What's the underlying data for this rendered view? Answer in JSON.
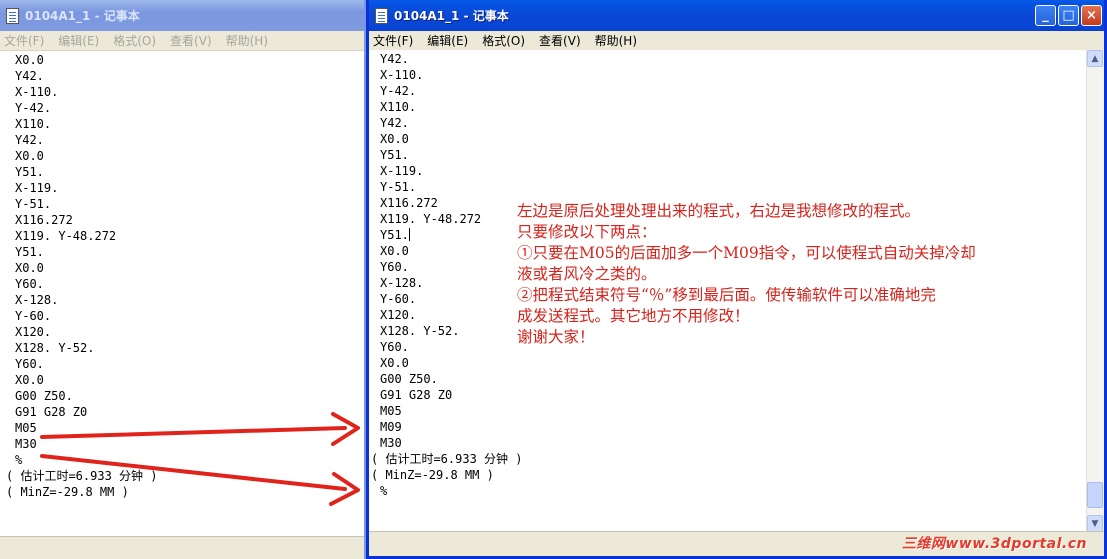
{
  "left_window": {
    "title": "0104A1_1 - 记事本",
    "menu": [
      "文件(F)",
      "编辑(E)",
      "格式(O)",
      "查看(V)",
      "帮助(H)"
    ],
    "lines": [
      "X0.0",
      "Y42.",
      "X-110.",
      "Y-42.",
      "X110.",
      "Y42.",
      "X0.0",
      "Y51.",
      "X-119.",
      "Y-51.",
      "X116.272",
      "X119. Y-48.272",
      "Y51.",
      "X0.0",
      "Y60.",
      "X-128.",
      "Y-60.",
      "X120.",
      "X128. Y-52.",
      "Y60.",
      "X0.0",
      "G00 Z50.",
      "G91 G28 Z0",
      "M05",
      "M30",
      "%",
      "( 估计工时=6.933 分钟 )",
      "( MinZ=-29.8 MM )"
    ],
    "outdented_from": 26
  },
  "right_window": {
    "title": "0104A1_1 - 记事本",
    "menu": [
      "文件(F)",
      "编辑(E)",
      "格式(O)",
      "查看(V)",
      "帮助(H)"
    ],
    "lines": [
      "Y42.",
      "X-110.",
      "Y-42.",
      "X110.",
      "Y42.",
      "X0.0",
      "Y51.",
      "X-119.",
      "Y-51.",
      "X116.272",
      "X119. Y-48.272",
      "Y51.",
      "X0.0",
      "Y60.",
      "X-128.",
      "Y-60.",
      "X120.",
      "X128. Y-52.",
      "Y60.",
      "X0.0",
      "G00 Z50.",
      "G91 G28 Z0",
      "M05",
      "M09",
      "M30",
      "( 估计工时=6.933 分钟 )",
      "( MinZ=-29.8 MM )",
      "%"
    ],
    "outdented_lines": [
      25,
      26
    ],
    "caret_line": 11,
    "controls": {
      "minimize": "_",
      "maximize": "□",
      "close": "×"
    }
  },
  "annotation": {
    "lines": [
      "左边是原后处理处理出来的程式，右边是我想修改的程式。",
      "只要修改以下两点：",
      "①只要在M05的后面加多一个M09指令，可以使程式自动关掉冷却",
      "  液或者风冷之类的。",
      "②把程式结束符号“％”移到最后面。使传输软件可以准确地完",
      "  成发送程式。其它地方不用修改！",
      "  谢谢大家！"
    ],
    "color": "#d7231b"
  },
  "watermark": "三维网www.3dportal.cn",
  "colors": {
    "titlebar_active": "#0a47d6",
    "titlebar_inactive": "#7a96df",
    "arrow": "#e0241c"
  }
}
